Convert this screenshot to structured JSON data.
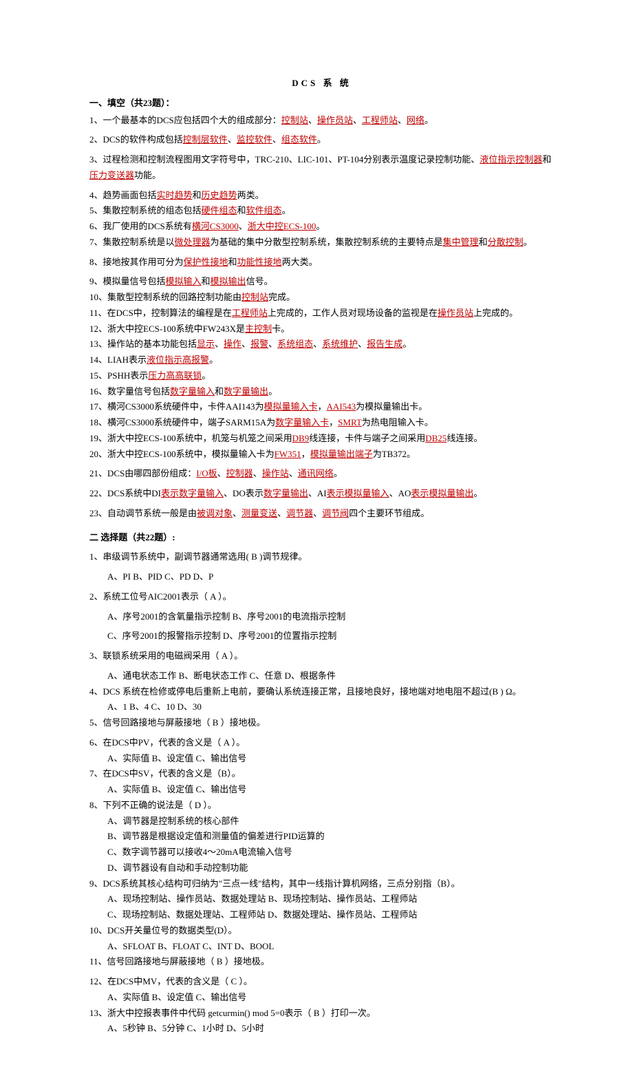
{
  "title": "DCS  系   统",
  "section1_title": "一、填空（共23题）：",
  "q1": {
    "pre": "1、一个最基本的DCS应包括四个大的组成部分：",
    "a1": "控制站",
    "a2": "操作员站",
    "a3": "工程师站",
    "a4": "网络",
    "post": "。",
    "s": "、"
  },
  "q2": {
    "pre": "2、DCS的软件构成包括",
    "a1": "控制层软件",
    "a2": "监控软件",
    "a3": "组态软件",
    "post": "。",
    "s": "、"
  },
  "q3": {
    "pre": "3、过程检测和控制流程图用文字符号中，TRC-210、LIC-101、PT-104分别表示温度记录控制功能、",
    "a1": "液位指示控制器",
    "mid": "和",
    "a2": "压力变送器",
    "post": "功能。"
  },
  "q4": {
    "pre": "4、趋势画面包括",
    "a1": "实时趋势",
    "mid": "和",
    "a2": "历史趋势",
    "post": "两类。"
  },
  "q5": {
    "pre": "5、集散控制系统的组态包括",
    "a1": "硬件组态",
    "mid": "和",
    "a2": "软件组态",
    "post": "。"
  },
  "q6": {
    "pre": "6、我厂使用的DCS系统有",
    "a1": "横河CS3000",
    "s": "、",
    "a2": "浙大中控ECS-100",
    "post": "。"
  },
  "q7": {
    "pre": "7、集散控制系统是以",
    "a1": "微处理器",
    "mid": "为基础的集中分散型控制系统，集散控制系统的主要特点是",
    "a2": "集中管理",
    "mid2": "和",
    "a3": "分散控制",
    "post": "。"
  },
  "q8": {
    "pre": "8、接地按其作用可分为",
    "a1": "保护性接地",
    "mid": "和",
    "a2": "功能性接地",
    "post": "两大类。"
  },
  "q9": {
    "pre": "9、模拟量信号包括",
    "a1": "模拟输入",
    "mid": "和",
    "a2": "模拟输出",
    "post": "信号。"
  },
  "q10": {
    "pre": "10、集散型控制系统的回路控制功能由",
    "a1": "控制站",
    "post": "完成。"
  },
  "q11": {
    "pre": "11、在DCS中，控制算法的编程是在",
    "a1": "工程师站",
    "mid": "上完成的，工作人员对现场设备的监视是在",
    "a2": "操作员站",
    "post": "上完成的。"
  },
  "q12": {
    "pre": "12、浙大中控ECS-100系统中FW243X是",
    "a1": "主控制",
    "post": "卡。"
  },
  "q13": {
    "pre": "13、操作站的基本功能包括",
    "a1": "显示",
    "a2": "操作",
    "a3": "报警",
    "a4": "系统组态",
    "a5": "系统维护",
    "a6": "报告生成",
    "s": "、",
    "post": "。"
  },
  "q14": {
    "pre": "14、LIAH表示",
    "a1": "液位指示高报警",
    "post": "。"
  },
  "q15": {
    "pre": "15、PSHH表示",
    "a1": "压力高高联锁",
    "post": "。"
  },
  "q16": {
    "pre": "16、数字量信号包括",
    "a1": "数字量输入",
    "mid": "和",
    "a2": "数字量输出",
    "post": "。"
  },
  "q17": {
    "pre": "17、横河CS3000系统硬件中，卡件AAI143为",
    "a1": "模拟量输入卡",
    "s": "，",
    "a2": "AAI543",
    "post": "为模拟量输出卡。"
  },
  "q18": {
    "pre": "18、横河CS3000系统硬件中，端子SARM15A为",
    "a1": "数字量输入卡",
    "s": "，",
    "a2": "SMRT",
    "post": "为热电阻输入卡。"
  },
  "q19": {
    "pre": "19、浙大中控ECS-100系统中，机笼与机笼之间采用",
    "a1": "DB9",
    "mid": "线连接，卡件与端子之间采用",
    "a2": "DB25",
    "post": "线连接。"
  },
  "q20": {
    "pre": "20、浙大中控ECS-100系统中，模拟量输入卡为",
    "a1": "FW351",
    "s": "，",
    "a2": "模拟量输出端子",
    "post": "为TB372。"
  },
  "q21": {
    "pre": "21、DCS由哪四部份组成：",
    "a1": "I/O板",
    "a2": "控制器",
    "a3": "操作站",
    "a4": "通讯网络",
    "s": "、",
    "post": "。"
  },
  "q22": {
    "pre": " 22、DCS系统中DI",
    "a1": "表示数字量输入",
    "m1": "、DO表示",
    "a2": "数字量输出",
    "m2": "、AI",
    "a3": "表示模拟量输入",
    "m3": "、AO",
    "a4": "表示模拟量输出",
    "post": "。"
  },
  "q23": {
    "pre": "23、自动调节系统一般是由",
    "a1": "被调对象",
    "a2": "测量变送",
    "a3": "调节器",
    "a4": "调节阀",
    "s": "、",
    "post": "四个主要环节组成。"
  },
  "section2_title": "二  选择题（共22题）:",
  "m1": {
    "t": "1、串级调节系统中，副调节器通常选用( B )调节规律。",
    "o": "A、PI       B、PID       C、PD       D、P"
  },
  "m2": {
    "t": "2、系统工位号AIC2001表示（ A ）。",
    "o1": "A、序号2001的含氧量指示控制    B、序号2001的电流指示控制",
    "o2": "C、序号2001的报警指示控制     D、序号2001的位置指示控制"
  },
  "m3": {
    "t": "3、联锁系统采用的电磁阀采用（ A ）。",
    "o": "A、通电状态工作    B、断电状态工作    C、任意   D、根据条件"
  },
  "m4": {
    "t": "4、DCS 系统在检修或停电后重新上电前，要确认系统连接正常，且接地良好，接地端对地电阻不超过(B  ) Ω。",
    "o": "A、1       B、4       C、10       D、30"
  },
  "m5": {
    "t": "5、信号回路接地与屏蔽接地（ B ）接地极。"
  },
  "m6": {
    "t": "6、在DCS中PV，代表的含义是（ A ）。",
    "o": "A、实际值    B、设定值    C、输出信号"
  },
  "m7": {
    "t": "7、在DCS中SV，代表的含义是（B）。",
    "o": "A、实际值    B、设定值    C、输出信号"
  },
  "m8": {
    "t": "8、下列不正确的说法是（ D ）。",
    "o1": "A、调节器是控制系统的核心部件",
    "o2": "B、调节器是根据设定值和测量值的偏差进行PID运算的",
    "o3": "C、数字调节器可以接收4～20mA电流输入信号",
    "o4": "D、调节器设有自动和手动控制功能"
  },
  "m9": {
    "t": "9、DCS系统其核心结构可归纳为\"三点一线\"结构，其中一线指计算机网络，三点分别指（B）。",
    "o1": "A、现场控制站、操作员站、数据处理站          B、现场控制站、操作员站、工程师站",
    "o2": "C、现场控制站、数据处理站、工程师站          D、数据处理站、操作员站、工程师站"
  },
  "m10": {
    "t": "10、DCS开关量位号的数据类型(D）。",
    "o": "A、SFLOAT      B、FLOAT     C、INT        D、BOOL"
  },
  "m11": {
    "t": "11、信号回路接地与屏蔽接地（ B ）接地极。"
  },
  "m12": {
    "t": "12、在DCS中MV，代表的含义是（ C ）。",
    "o": "A、实际值      B、设定值    C、输出信号"
  },
  "m13": {
    "t": "13、浙大中控报表事件中代码 getcurmin() mod 5=0表示（ B ）打印一次。",
    "o": "A、5秒钟        B、5分钟      C、1小时      D、5小时"
  }
}
